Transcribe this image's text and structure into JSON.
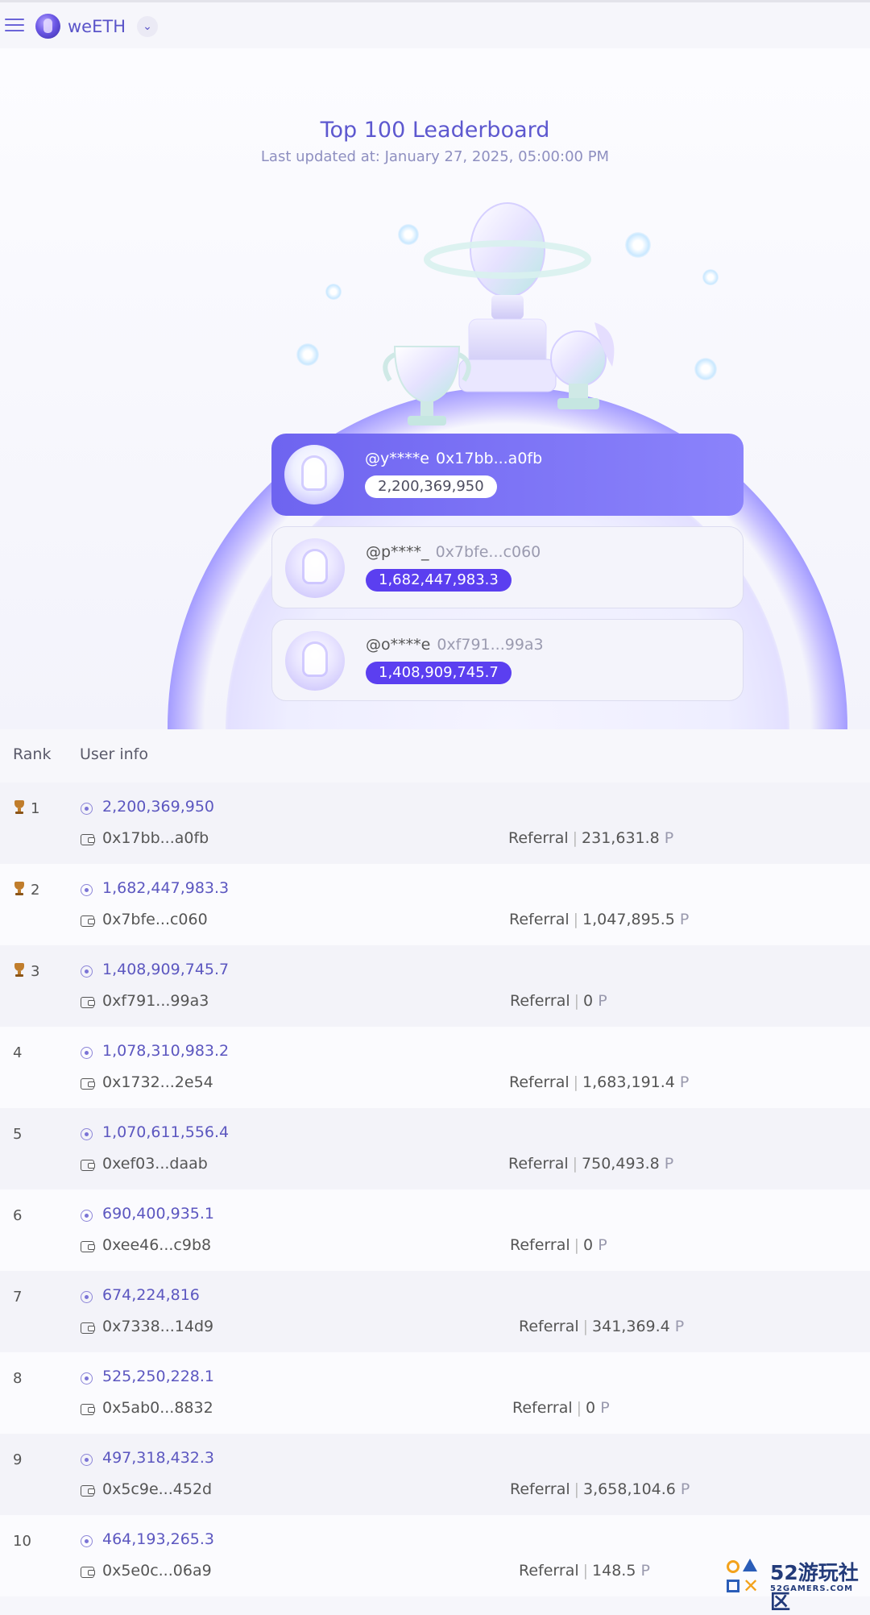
{
  "header": {
    "brand_name": "weETH",
    "brand_dropdown_glyph": "⌄",
    "icons": [
      "menu-icon",
      "weeth-logo-icon",
      "chevron-down-icon"
    ]
  },
  "hero": {
    "title": "Top 100 Leaderboard",
    "updated": "Last updated at: January 27, 2025, 05:00:00 PM"
  },
  "podium": [
    {
      "handle": "@y****e",
      "address": "0x17bb...a0fb",
      "points": "2,200,369,950"
    },
    {
      "handle": "@p****_",
      "address": "0x7bfe...c060",
      "points": "1,682,447,983.3"
    },
    {
      "handle": "@o****e",
      "address": "0xf791...99a3",
      "points": "1,408,909,745.7"
    }
  ],
  "table": {
    "headers": {
      "rank": "Rank",
      "user_info": "User info"
    },
    "referral_label": "Referral",
    "separator": "|",
    "unit": "P",
    "rows": [
      {
        "rank": "1",
        "points": "2,200,369,950",
        "wallet": "0x17bb...a0fb",
        "referral": "231,631.8"
      },
      {
        "rank": "2",
        "points": "1,682,447,983.3",
        "wallet": "0x7bfe...c060",
        "referral": "1,047,895.5"
      },
      {
        "rank": "3",
        "points": "1,408,909,745.7",
        "wallet": "0xf791...99a3",
        "referral": "0"
      },
      {
        "rank": "4",
        "points": "1,078,310,983.2",
        "wallet": "0x1732...2e54",
        "referral": "1,683,191.4"
      },
      {
        "rank": "5",
        "points": "1,070,611,556.4",
        "wallet": "0xef03...daab",
        "referral": "750,493.8"
      },
      {
        "rank": "6",
        "points": "690,400,935.1",
        "wallet": "0xee46...c9b8",
        "referral": "0"
      },
      {
        "rank": "7",
        "points": "674,224,816",
        "wallet": "0x7338...14d9",
        "referral": "341,369.4"
      },
      {
        "rank": "8",
        "points": "525,250,228.1",
        "wallet": "0x5ab0...8832",
        "referral": "0"
      },
      {
        "rank": "9",
        "points": "497,318,432.3",
        "wallet": "0x5c9e...452d",
        "referral": "3,658,104.6"
      },
      {
        "rank": "10",
        "points": "464,193,265.3",
        "wallet": "0x5e0c...06a9",
        "referral": "148.5"
      }
    ]
  },
  "watermark": {
    "text": "52游玩社区",
    "sub": "52GAMERS.COM",
    "x_glyph": "✕"
  }
}
